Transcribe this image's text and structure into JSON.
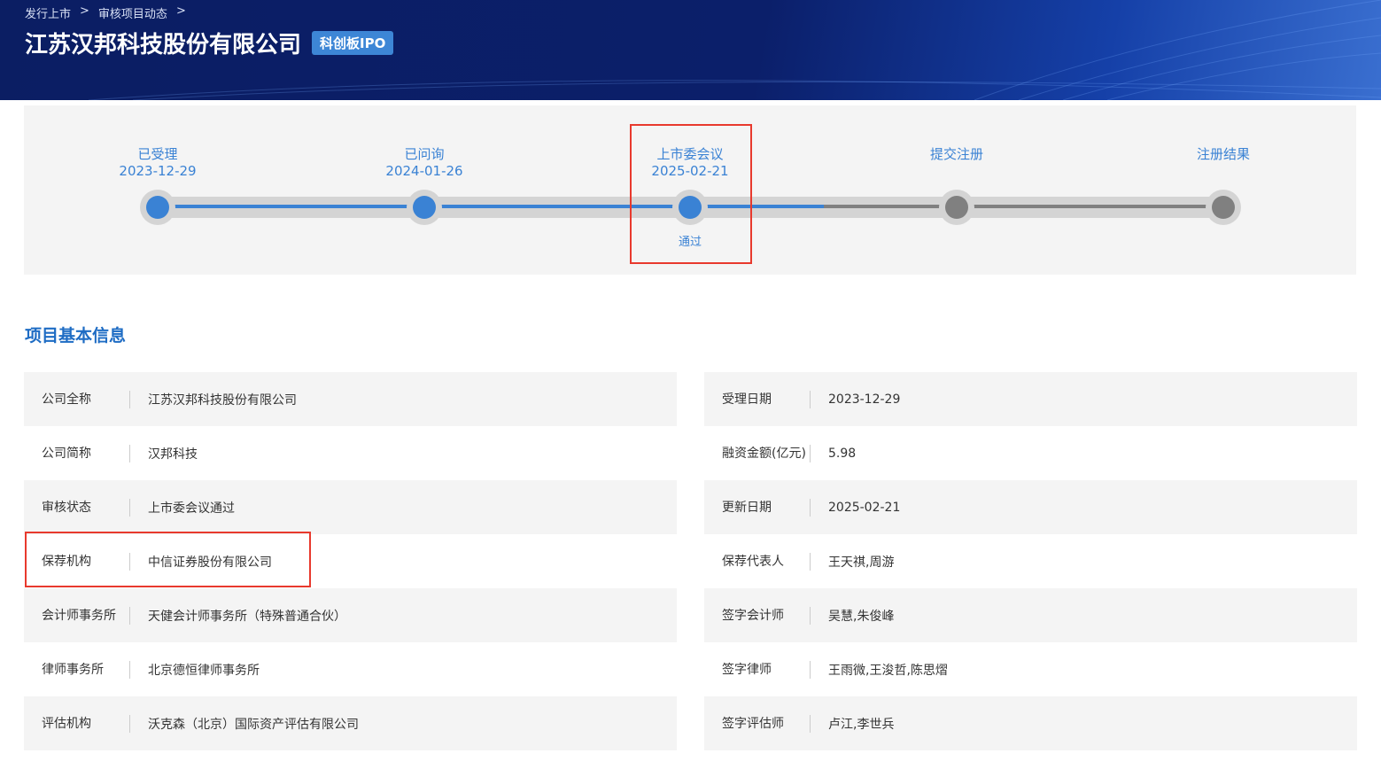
{
  "breadcrumb": [
    "发行上市",
    "审核项目动态"
  ],
  "title": "江苏汉邦科技股份有限公司",
  "badge": "科创板IPO",
  "progress": {
    "steps": [
      {
        "label": "已受理",
        "date": "2023-12-29",
        "done": true
      },
      {
        "label": "已问询",
        "date": "2024-01-26",
        "done": true
      },
      {
        "label": "上市委会议",
        "date": "2025-02-21",
        "done": true,
        "result": "通过"
      },
      {
        "label": "提交注册",
        "date": "",
        "done": false
      },
      {
        "label": "注册结果",
        "date": "",
        "done": false
      }
    ],
    "colors": {
      "done": "#3a82d4",
      "pending": "#808080"
    }
  },
  "section_title": "项目基本信息",
  "left": [
    {
      "k": "公司全称",
      "v": "江苏汉邦科技股份有限公司"
    },
    {
      "k": "公司简称",
      "v": "汉邦科技"
    },
    {
      "k": "审核状态",
      "v": "上市委会议通过"
    },
    {
      "k": "保荐机构",
      "v": "中信证券股份有限公司"
    },
    {
      "k": "会计师事务所",
      "v": "天健会计师事务所（特殊普通合伙）"
    },
    {
      "k": "律师事务所",
      "v": "北京德恒律师事务所"
    },
    {
      "k": "评估机构",
      "v": "沃克森（北京）国际资产评估有限公司"
    }
  ],
  "right": [
    {
      "k": "受理日期",
      "v": "2023-12-29"
    },
    {
      "k": "融资金额(亿元)",
      "v": "5.98"
    },
    {
      "k": "更新日期",
      "v": "2025-02-21"
    },
    {
      "k": "保荐代表人",
      "v": "王天祺,周游"
    },
    {
      "k": "签字会计师",
      "v": "吴慧,朱俊峰"
    },
    {
      "k": "签字律师",
      "v": "王雨微,王浚哲,陈思熠"
    },
    {
      "k": "签字评估师",
      "v": "卢江,李世兵"
    }
  ]
}
